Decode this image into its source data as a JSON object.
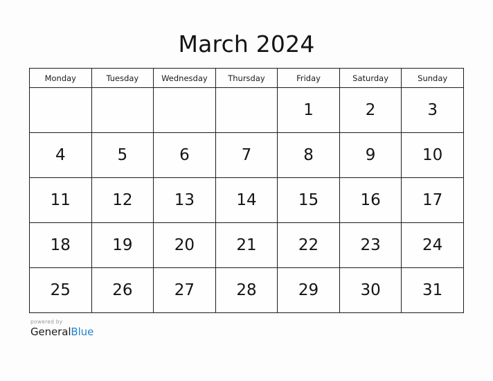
{
  "colors": {
    "page_background": "#fdfdfd",
    "grid_border": "#1c1c1c",
    "text": "#141414",
    "muted_text": "#9a9a9a",
    "brand_blue": "#2481d0"
  },
  "header": {
    "title": "March 2024"
  },
  "calendar": {
    "weekday_headers": [
      "Monday",
      "Tuesday",
      "Wednesday",
      "Thursday",
      "Friday",
      "Saturday",
      "Sunday"
    ],
    "weeks": [
      [
        "",
        "",
        "",
        "",
        "1",
        "2",
        "3"
      ],
      [
        "4",
        "5",
        "6",
        "7",
        "8",
        "9",
        "10"
      ],
      [
        "11",
        "12",
        "13",
        "14",
        "15",
        "16",
        "17"
      ],
      [
        "18",
        "19",
        "20",
        "21",
        "22",
        "23",
        "24"
      ],
      [
        "25",
        "26",
        "27",
        "28",
        "29",
        "30",
        "31"
      ]
    ]
  },
  "footer": {
    "powered_by": "powered by",
    "brand_first": "General",
    "brand_second": "Blue"
  }
}
